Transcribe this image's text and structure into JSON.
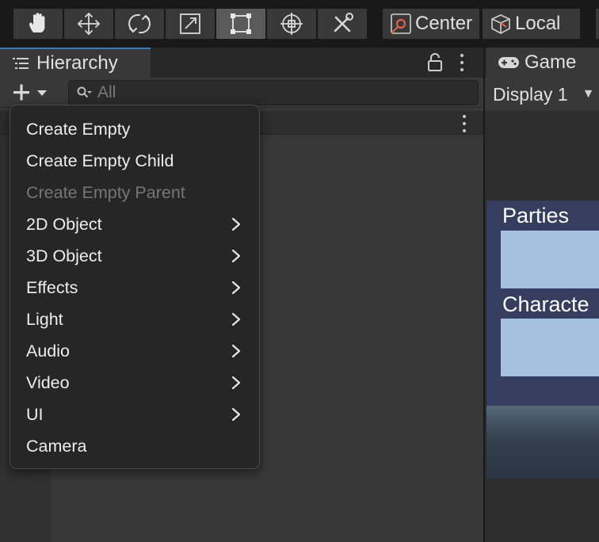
{
  "toolbar": {
    "tools": [
      {
        "name": "hand-tool",
        "icon": "hand-icon",
        "active": false
      },
      {
        "name": "move-tool",
        "icon": "move-icon",
        "active": false
      },
      {
        "name": "rotate-tool",
        "icon": "rotate-icon",
        "active": false
      },
      {
        "name": "scale-tool",
        "icon": "scale-icon",
        "active": false
      },
      {
        "name": "rect-tool",
        "icon": "rect-transform-icon",
        "active": true
      },
      {
        "name": "transform-tool",
        "icon": "transform-icon",
        "active": false
      },
      {
        "name": "custom-tool",
        "icon": "tools-icon",
        "active": false
      }
    ],
    "pivot_mode_label": "Center",
    "pivot_rotation_label": "Local"
  },
  "hierarchy": {
    "tab_label": "Hierarchy",
    "search_placeholder": "All"
  },
  "create_menu": {
    "items": [
      {
        "label": "Create Empty",
        "enabled": true,
        "submenu": false
      },
      {
        "label": "Create Empty Child",
        "enabled": true,
        "submenu": false
      },
      {
        "label": "Create Empty Parent",
        "enabled": false,
        "submenu": false
      },
      {
        "label": "2D Object",
        "enabled": true,
        "submenu": true
      },
      {
        "label": "3D Object",
        "enabled": true,
        "submenu": true
      },
      {
        "label": "Effects",
        "enabled": true,
        "submenu": true
      },
      {
        "label": "Light",
        "enabled": true,
        "submenu": true
      },
      {
        "label": "Audio",
        "enabled": true,
        "submenu": true
      },
      {
        "label": "Video",
        "enabled": true,
        "submenu": true
      },
      {
        "label": "UI",
        "enabled": true,
        "submenu": true
      },
      {
        "label": "Camera",
        "enabled": true,
        "submenu": false
      }
    ]
  },
  "game": {
    "tab_label": "Game",
    "display_label": "Display 1",
    "canvas_labels": [
      "Parties",
      "Characte"
    ]
  },
  "colors": {
    "accent": "#3a79bb",
    "panel": "#383838",
    "menu_bg": "#262626",
    "canvas_bg": "#363e60",
    "canvas_box": "#a6c1e0",
    "center_icon": "#e0624a"
  }
}
